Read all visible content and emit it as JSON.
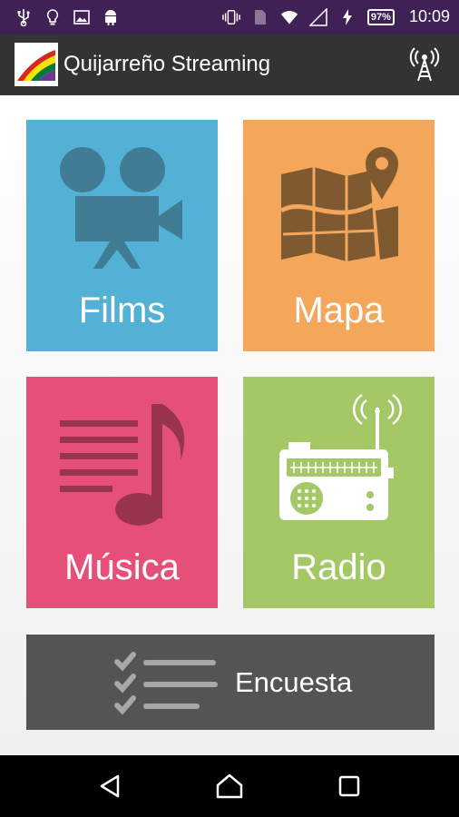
{
  "status_bar": {
    "time": "10:09",
    "battery": "97%",
    "icons": [
      "usb-icon",
      "bulb-icon",
      "image-icon",
      "android-icon",
      "vibrate-icon",
      "sim-icon",
      "wifi-icon",
      "signal-icon",
      "charging-icon",
      "battery-icon"
    ]
  },
  "app_bar": {
    "title": "Quijarreño Streaming",
    "action_icon": "radio-tower-icon"
  },
  "tiles": [
    {
      "id": "films",
      "label": "Films",
      "icon": "movie-camera-icon",
      "color": "#53b1d6"
    },
    {
      "id": "mapa",
      "label": "Mapa",
      "icon": "map-pin-icon",
      "color": "#f4a65b"
    },
    {
      "id": "musica",
      "label": "Música",
      "icon": "music-note-icon",
      "color": "#e65078"
    },
    {
      "id": "radio",
      "label": "Radio",
      "icon": "radio-icon",
      "color": "#a3c865"
    }
  ],
  "survey": {
    "label": "Encuesta",
    "icon": "checklist-icon",
    "color": "#545454"
  },
  "nav_bar": {
    "icons": [
      "back-icon",
      "home-icon",
      "recents-icon"
    ]
  }
}
